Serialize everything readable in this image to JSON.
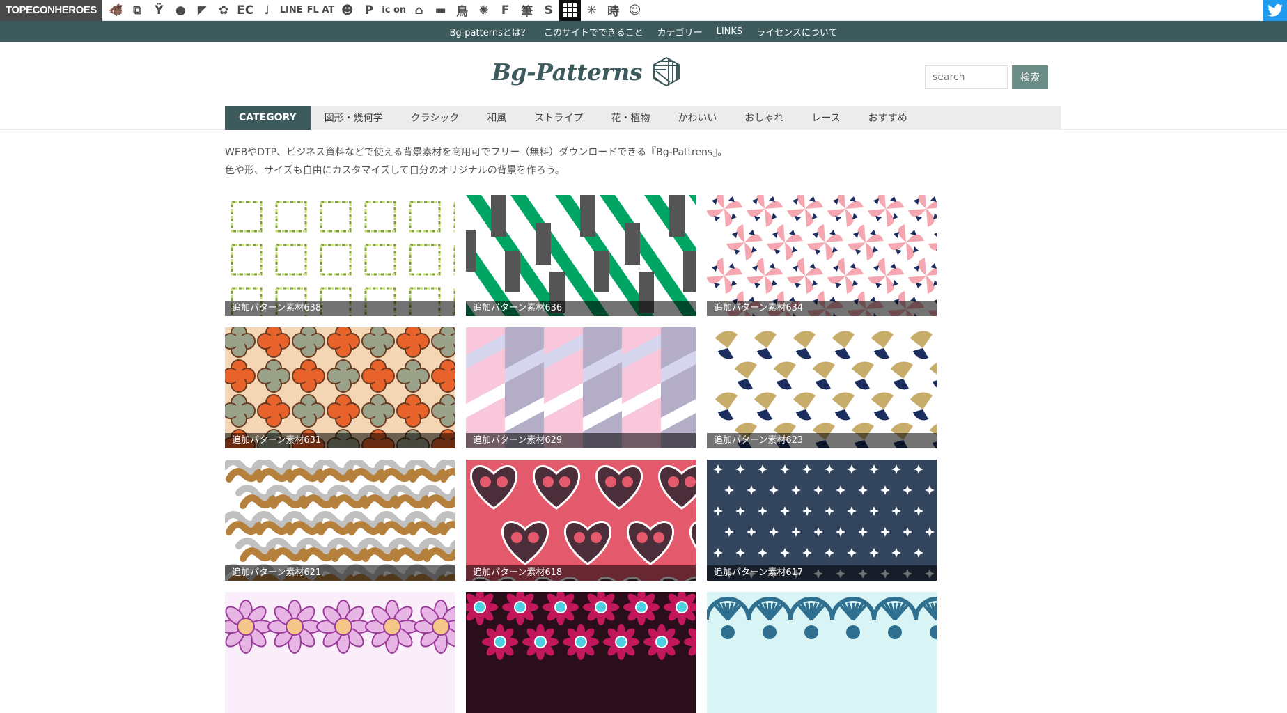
{
  "topbar": {
    "brand": "TOPECONHEROES",
    "icons": [
      {
        "name": "pig-icon",
        "glyph": "🐗"
      },
      {
        "name": "overlap-icon",
        "glyph": "⧉"
      },
      {
        "name": "person-icon",
        "glyph": "Ÿ"
      },
      {
        "name": "speech-bubble-icon",
        "glyph": "●"
      },
      {
        "name": "flag-icon",
        "glyph": "◤"
      },
      {
        "name": "flower-icon",
        "glyph": "✿"
      },
      {
        "name": "ec-icon",
        "glyph": "EC"
      },
      {
        "name": "note-icon",
        "glyph": "♩"
      },
      {
        "name": "line-icon",
        "glyph": "LINE"
      },
      {
        "name": "flat-icon",
        "glyph": "FL AT"
      },
      {
        "name": "smile-icon",
        "glyph": "☻"
      },
      {
        "name": "p-icon",
        "glyph": "P"
      },
      {
        "name": "icon-text-icon",
        "glyph": "ic on"
      },
      {
        "name": "house-icon",
        "glyph": "⌂"
      },
      {
        "name": "sofa-icon",
        "glyph": "▬"
      },
      {
        "name": "bird-icon",
        "glyph": "鳥"
      },
      {
        "name": "pattern-icon",
        "glyph": "✺"
      },
      {
        "name": "f-icon",
        "glyph": "F"
      },
      {
        "name": "brush-icon",
        "glyph": "筆"
      },
      {
        "name": "s-icon",
        "glyph": "S"
      },
      {
        "name": "grid-icon",
        "glyph": ""
      },
      {
        "name": "burst-icon",
        "glyph": "✳"
      },
      {
        "name": "time-icon",
        "glyph": "時"
      },
      {
        "name": "face-icon",
        "glyph": "☺"
      }
    ]
  },
  "nav": [
    "Bg-patternsとは？",
    "このサイトでできること",
    "カテゴリー",
    "LINKS",
    "ライセンスについて"
  ],
  "header": {
    "logo": "Bg-Patterns",
    "search_placeholder": "search",
    "search_button": "検索"
  },
  "categories": [
    "CATEGORY",
    "図形・幾何学",
    "クラシック",
    "和風",
    "ストライプ",
    "花・植物",
    "かわいい",
    "おしゃれ",
    "レース",
    "おすすめ"
  ],
  "intro": [
    "WEBやDTP、ビジネス資料などで使える背景素材を商用可でフリー（無料）ダウンロードできる『Bg-Pattrens』。",
    "色や形、サイズも自由にカスタマイズして自分のオリジナルの背景を作ろう。"
  ],
  "tiles": [
    {
      "caption": "追加パターン素材638",
      "pattern": "squares"
    },
    {
      "caption": "追加パターン素材636",
      "pattern": "stripes"
    },
    {
      "caption": "追加パターン素材634",
      "pattern": "pinwheel"
    },
    {
      "caption": "追加パターン素材631",
      "pattern": "clover"
    },
    {
      "caption": "追加パターン素材629",
      "pattern": "diamonds"
    },
    {
      "caption": "追加パターン素材623",
      "pattern": "fans"
    },
    {
      "caption": "追加パターン素材621",
      "pattern": "squiggle"
    },
    {
      "caption": "追加パターン素材618",
      "pattern": "hearts"
    },
    {
      "caption": "追加パターン素材617",
      "pattern": "stars"
    },
    {
      "caption": "",
      "pattern": "mandala"
    },
    {
      "caption": "",
      "pattern": "rosette"
    },
    {
      "caption": "",
      "pattern": "scallop"
    }
  ],
  "colors": {
    "accent": "#3d5a5d",
    "search_button": "#6a8c86",
    "twitter": "#1d9bf0"
  }
}
